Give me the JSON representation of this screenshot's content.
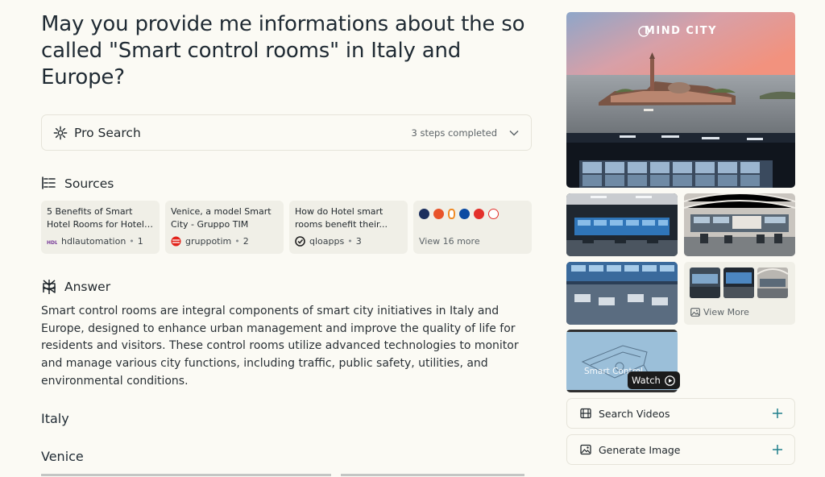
{
  "question": "May you provide me informations about the so called \"Smart control rooms\" in Italy and Europe?",
  "pro_search": {
    "label": "Pro Search",
    "steps": "3 steps completed"
  },
  "sources": {
    "heading": "Sources",
    "items": [
      {
        "title": "5 Benefits of Smart Hotel Rooms for Hotel Owners...",
        "domain": "hdlautomation",
        "index": "1"
      },
      {
        "title": "Venice, a model Smart City - Gruppo TIM",
        "domain": "gruppotim",
        "index": "2"
      },
      {
        "title": "How do Hotel smart rooms benefit their...",
        "domain": "qloapps",
        "index": "3"
      }
    ],
    "view_more": "View 16 more"
  },
  "answer": {
    "heading": "Answer",
    "text": "Smart control rooms are integral components of smart city initiatives in Italy and Europe, designed to enhance urban management and improve the quality of life for residents and visitors. These control rooms utilize advanced technologies to monitor and manage various city functions, including traffic, public safety, utilities, and environmental conditions.",
    "subheading_1": "Italy",
    "subheading_2": "Venice"
  },
  "media": {
    "brand_text": "MIND CITY",
    "view_more": "View More",
    "video_caption": "Smart Control",
    "watch": "Watch"
  },
  "actions": {
    "search_videos": "Search Videos",
    "generate_image": "Generate Image"
  },
  "colors": {
    "background": "#fbfaf4",
    "card": "#f0efe7",
    "border": "#e6e4da",
    "accent": "#20808d"
  }
}
